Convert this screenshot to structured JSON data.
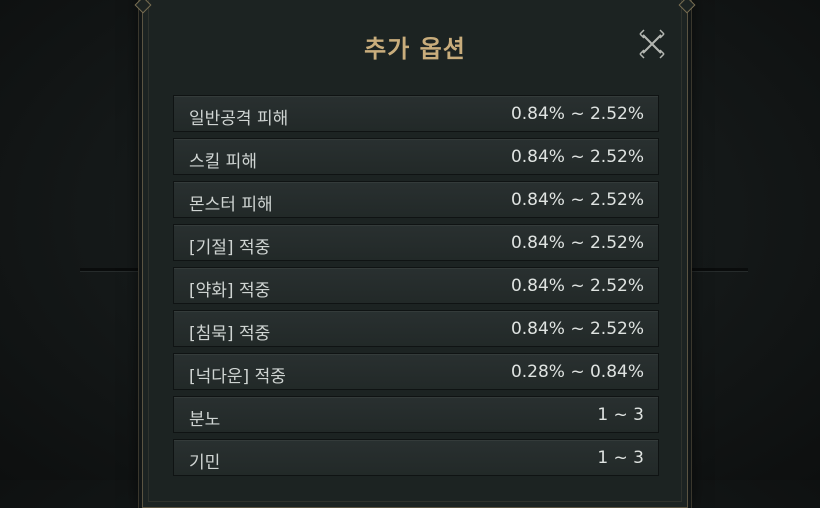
{
  "dialog": {
    "title": "추가 옵션",
    "close_icon": "close-x-icon"
  },
  "options": [
    {
      "name": "일반공격 피해",
      "range": "0.84% ~ 2.52%"
    },
    {
      "name": "스킬 피해",
      "range": "0.84% ~ 2.52%"
    },
    {
      "name": "몬스터 피해",
      "range": "0.84% ~ 2.52%"
    },
    {
      "name": "[기절] 적중",
      "range": "0.84% ~ 2.52%"
    },
    {
      "name": "[약화] 적중",
      "range": "0.84% ~ 2.52%"
    },
    {
      "name": "[침묵] 적중",
      "range": "0.84% ~ 2.52%"
    },
    {
      "name": "[넉다운] 적중",
      "range": "0.28% ~ 0.84%"
    },
    {
      "name": "분노",
      "range": "1 ~ 3"
    },
    {
      "name": "기민",
      "range": "1 ~ 3"
    }
  ],
  "colors": {
    "title": "#c9ad7c",
    "panel": "#1c2322",
    "row": "#262d2c",
    "frame": "#5b5442"
  }
}
